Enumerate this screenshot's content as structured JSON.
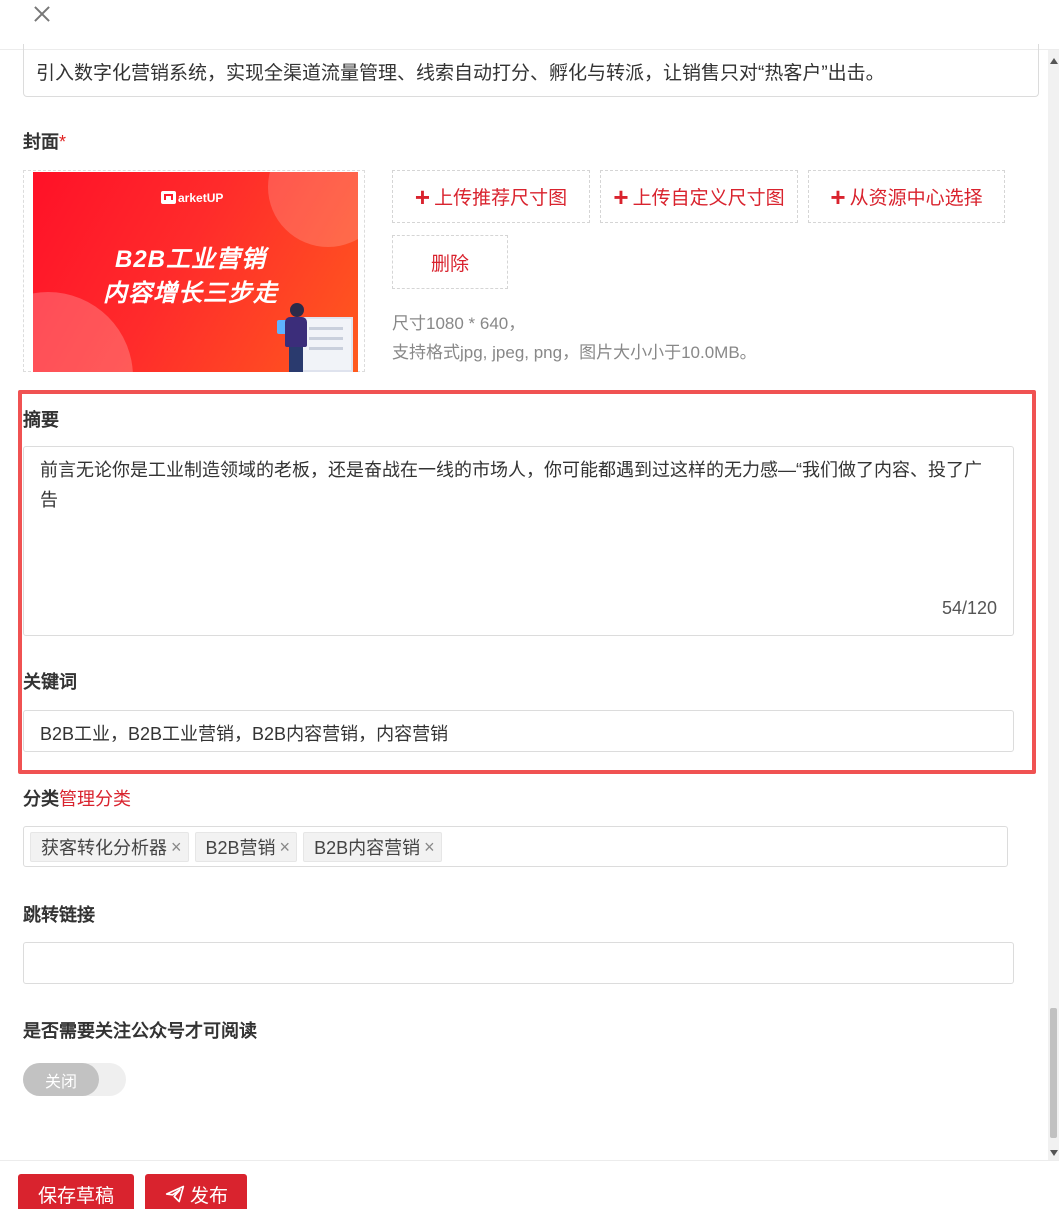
{
  "header": {
    "close_icon": "close-icon"
  },
  "description": {
    "value": "引入数字化营销系统，实现全渠道流量管理、线索自动打分、孵化与转派，让销售只对“热客户”出击。"
  },
  "cover": {
    "label": "封面",
    "required_mark": "*",
    "image": {
      "brand": "arketUP",
      "line1": "B2B工业营销",
      "line2": "内容增长三步走"
    },
    "upload_recommended": "上传推荐尺寸图",
    "upload_custom": "上传自定义尺寸图",
    "select_from_resources": "从资源中心选择",
    "delete": "删除",
    "hint_size": "尺寸1080 * 640，",
    "hint_format": "支持格式jpg, jpeg, png，图片大小小于10.0MB。"
  },
  "summary": {
    "label": "摘要",
    "value": "前言无论你是工业制造领域的老板，还是奋战在一线的市场人，你可能都遇到过这样的无力感—“我们做了内容、投了广告",
    "counter": "54/120"
  },
  "keywords": {
    "label": "关键词",
    "value": "B2B工业，B2B工业营销，B2B内容营销，内容营销"
  },
  "category": {
    "label": "分类",
    "manage_link": "管理分类",
    "tags": [
      {
        "label": "获客转化分析器"
      },
      {
        "label": "B2B营销"
      },
      {
        "label": "B2B内容营销"
      }
    ],
    "remove_symbol": "×"
  },
  "redirect": {
    "label": "跳转链接",
    "value": ""
  },
  "follow_required": {
    "label": "是否需要关注公众号才可阅读",
    "toggle_label": "关闭",
    "enabled": false
  },
  "footer": {
    "save_draft": "保存草稿",
    "publish": "发布"
  },
  "colors": {
    "accent": "#d9232e",
    "highlight_border": "#f05252"
  }
}
